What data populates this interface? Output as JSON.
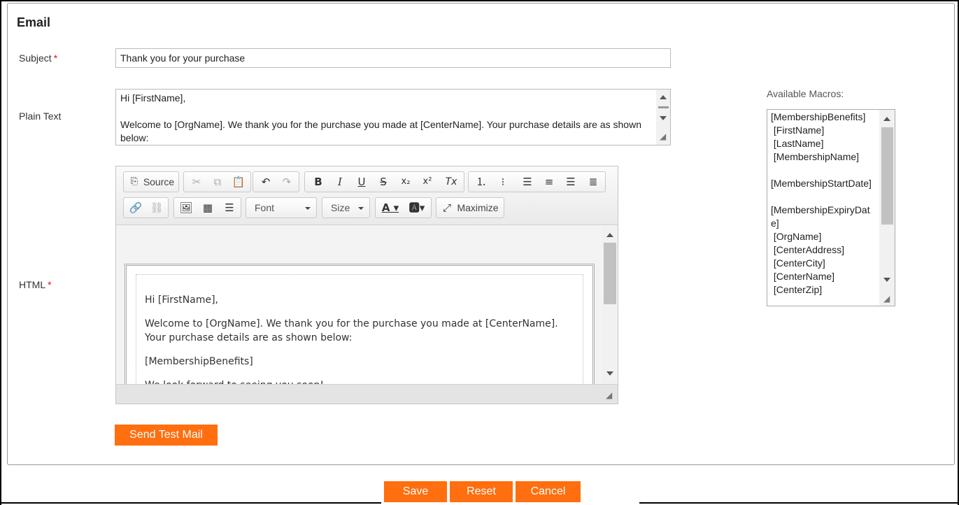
{
  "section": {
    "title": "Email"
  },
  "subject": {
    "label": "Subject",
    "required_mark": "*",
    "value": "Thank you for your purchase"
  },
  "plain_text": {
    "label": "Plain Text",
    "value": "Hi [FirstName],\n\nWelcome to [OrgName]. We thank you for the purchase you made at [CenterName]. Your purchase details are as shown below:"
  },
  "html": {
    "label": "HTML",
    "required_mark": "*",
    "toolbar": {
      "source_label": "Source",
      "font_label": "Font",
      "size_label": "Size",
      "maximize_label": "Maximize",
      "icons": {
        "source": "source-icon",
        "cut": "cut-icon",
        "copy": "copy-icon",
        "paste": "paste-icon",
        "undo": "undo-icon",
        "redo": "redo-icon",
        "bold": "B",
        "italic": "I",
        "underline": "U",
        "strike": "S",
        "subscript": "x₂",
        "superscript": "x²",
        "remove_format": "Tx"
      }
    },
    "content": {
      "greeting": "Hi [FirstName],",
      "paragraph1": "Welcome to [OrgName]. We thank you for the purchase you made at [CenterName]. Your purchase details are as shown below:",
      "paragraph2": "[MembershipBenefits]",
      "paragraph3": "We look forward to seeing you soon!"
    }
  },
  "macros": {
    "label": "Available Macros:",
    "items": [
      "[MembershipBenefits]",
      " [FirstName]",
      " [LastName]",
      " [MembershipName]",
      "",
      "[MembershipStartDate]",
      "",
      "[MembershipExpiryDate]",
      " [OrgName]",
      " [CenterAddress]",
      " [CenterCity]",
      " [CenterName]",
      " [CenterZip]"
    ]
  },
  "buttons": {
    "send_test_mail": "Send Test Mail",
    "save": "Save",
    "reset": "Reset",
    "cancel": "Cancel"
  },
  "colors": {
    "accent": "#ff6e0f",
    "required": "#d9181b"
  }
}
